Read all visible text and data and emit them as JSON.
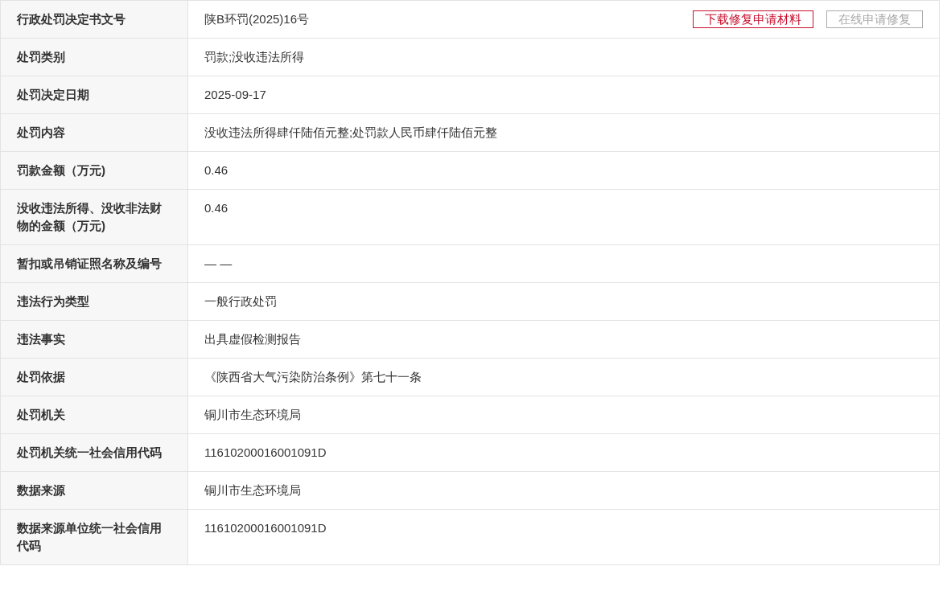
{
  "rows": [
    {
      "label": "行政处罚决定书文号",
      "value": "陕B环罚(2025)16号",
      "buttons": [
        {
          "label": "下载修复申请材料",
          "disabled": false
        },
        {
          "label": "在线申请修复",
          "disabled": true
        }
      ]
    },
    {
      "label": "处罚类别",
      "value": "罚款;没收违法所得"
    },
    {
      "label": "处罚决定日期",
      "value": "2025-09-17"
    },
    {
      "label": "处罚内容",
      "value": "没收违法所得肆仟陆佰元整;处罚款人民币肆仟陆佰元整"
    },
    {
      "label": "罚款金额（万元)",
      "value": "0.46"
    },
    {
      "label": "没收违法所得、没收非法财物的金额（万元)",
      "value": "0.46"
    },
    {
      "label": "暂扣或吊销证照名称及编号",
      "value": "— —"
    },
    {
      "label": "违法行为类型",
      "value": "一般行政处罚"
    },
    {
      "label": "违法事实",
      "value": "出具虚假检测报告"
    },
    {
      "label": "处罚依据",
      "value": "《陕西省大气污染防治条例》第七十一条"
    },
    {
      "label": "处罚机关",
      "value": "铜川市生态环境局"
    },
    {
      "label": "处罚机关统一社会信用代码",
      "value": "11610200016001091D"
    },
    {
      "label": "数据来源",
      "value": "铜川市生态环境局"
    },
    {
      "label": "数据来源单位统一社会信用代码",
      "value": "11610200016001091D"
    }
  ]
}
